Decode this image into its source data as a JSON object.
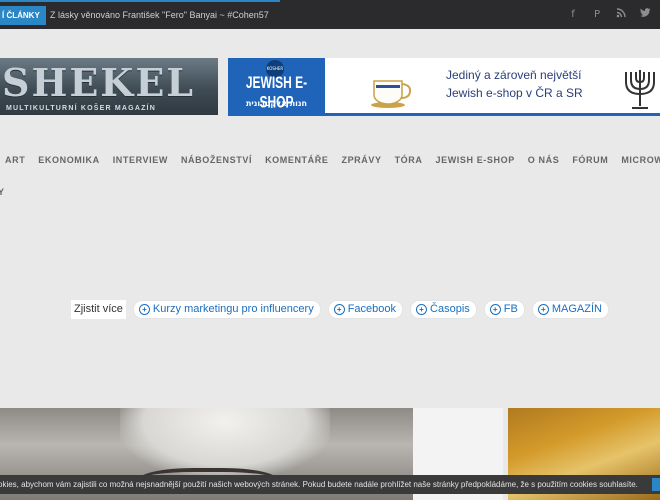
{
  "topbar": {
    "latest_label": "Í ČLÁNKY",
    "ticker_text": "Z lásky věnováno František \"Fero\" Banyai ~ #Cohen57",
    "social": [
      "facebook-icon",
      "pinterest-icon",
      "rss-icon",
      "twitter-icon"
    ],
    "social_glyphs": [
      "f",
      "P",
      "⌇",
      "t"
    ]
  },
  "logo": {
    "title": "SHEKEL",
    "subtitle": "MULTIKULTURNÍ KOŠER MAGAZÍN"
  },
  "banner": {
    "badge": "KOSHER",
    "shop_title": "JEWISH E-SHOP",
    "shop_hebrew": "חנות אלקטרונית",
    "line1": "Jediný a zároveň největší",
    "line2": "Jewish e-shop v ČR a SR"
  },
  "nav": {
    "items": [
      "ART",
      "EKONOMIKA",
      "INTERVIEW",
      "NÁBOŽENSTVÍ",
      "KOMENTÁŘE",
      "ZPRÁVY",
      "TÓRA",
      "JEWISH E-SHOP",
      "O NÁS",
      "FÓRUM",
      "MICROWEBY"
    ],
    "overflow": "Y"
  },
  "ads": {
    "label": "Zjistit více",
    "chips": [
      "Kurzy marketingu pro influencery",
      "Facebook",
      "Časopis",
      "FB",
      "MAGAZÍN"
    ]
  },
  "cookie": {
    "text": "okies, abychom vám zajistili co možná nejsnadnější použití našich webových stránek. Pokud budete nadále prohlížet naše stránky předpokládáme, že s použitím cookies souhlasíte."
  },
  "colors": {
    "accent": "#2b86c5",
    "topbar": "#2b2b2d",
    "background": "#e9e9e9",
    "link": "#1a6fc0"
  }
}
